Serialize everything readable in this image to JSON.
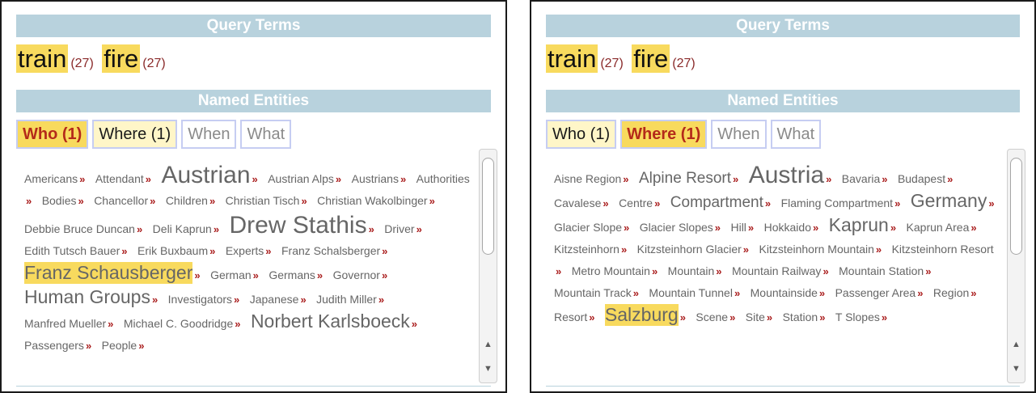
{
  "panels": [
    {
      "query_header": "Query Terms",
      "query_terms": [
        {
          "term": "train",
          "count": "(27)"
        },
        {
          "term": "fire",
          "count": "(27)"
        }
      ],
      "named_header": "Named Entities",
      "tabs": [
        "Who (1)",
        "Where (1)",
        "When",
        "What"
      ],
      "selected_tab": "Who (1)",
      "cloud": [
        {
          "text": "Americans",
          "size": 1
        },
        {
          "text": "Attendant",
          "size": 1
        },
        {
          "text": "Austrian",
          "size": 4
        },
        {
          "text": "Austrian Alps",
          "size": 1
        },
        {
          "text": "Austrians",
          "size": 1
        },
        {
          "text": "Authorities",
          "size": 1
        },
        {
          "text": "Bodies",
          "size": 1
        },
        {
          "text": "Chancellor",
          "size": 1
        },
        {
          "text": "Children",
          "size": 1
        },
        {
          "text": "Christian Tisch",
          "size": 1
        },
        {
          "text": "Christian Wakolbinger",
          "size": 1
        },
        {
          "text": "Debbie Bruce Duncan",
          "size": 1
        },
        {
          "text": "Deli Kaprun",
          "size": 1
        },
        {
          "text": "Drew Stathis",
          "size": 4
        },
        {
          "text": "Driver",
          "size": 1
        },
        {
          "text": "Edith Tutsch Bauer",
          "size": 1
        },
        {
          "text": "Erik Buxbaum",
          "size": 1
        },
        {
          "text": "Experts",
          "size": 1
        },
        {
          "text": "Franz Schalsberger",
          "size": 1
        },
        {
          "text": "Franz Schausberger",
          "size": 3,
          "highlight": true
        },
        {
          "text": "German",
          "size": 1
        },
        {
          "text": "Germans",
          "size": 1
        },
        {
          "text": "Governor",
          "size": 1
        },
        {
          "text": "Human Groups",
          "size": 3
        },
        {
          "text": "Investigators",
          "size": 1
        },
        {
          "text": "Japanese",
          "size": 1
        },
        {
          "text": "Judith Miller",
          "size": 1
        },
        {
          "text": "Manfred Mueller",
          "size": 1
        },
        {
          "text": "Michael C. Goodridge",
          "size": 1
        },
        {
          "text": "Norbert Karlsboeck",
          "size": 3
        },
        {
          "text": "Passengers",
          "size": 1
        },
        {
          "text": "People",
          "size": 1
        }
      ]
    },
    {
      "query_header": "Query Terms",
      "query_terms": [
        {
          "term": "train",
          "count": "(27)"
        },
        {
          "term": "fire",
          "count": "(27)"
        }
      ],
      "named_header": "Named Entities",
      "tabs": [
        "Who (1)",
        "Where (1)",
        "When",
        "What"
      ],
      "selected_tab": "Where (1)",
      "cloud": [
        {
          "text": "Aisne Region",
          "size": 1
        },
        {
          "text": "Alpine Resort",
          "size": 2
        },
        {
          "text": "Austria",
          "size": 4
        },
        {
          "text": "Bavaria",
          "size": 1
        },
        {
          "text": "Budapest",
          "size": 1
        },
        {
          "text": "Cavalese",
          "size": 1
        },
        {
          "text": "Centre",
          "size": 1
        },
        {
          "text": "Compartment",
          "size": 2
        },
        {
          "text": "Flaming Compartment",
          "size": 1
        },
        {
          "text": "Germany",
          "size": 3
        },
        {
          "text": "Glacier Slope",
          "size": 1
        },
        {
          "text": "Glacier Slopes",
          "size": 1
        },
        {
          "text": "Hill",
          "size": 1
        },
        {
          "text": "Hokkaido",
          "size": 1
        },
        {
          "text": "Kaprun",
          "size": 3
        },
        {
          "text": "Kaprun Area",
          "size": 1
        },
        {
          "text": "Kitzsteinhorn",
          "size": 1
        },
        {
          "text": "Kitzsteinhorn Glacier",
          "size": 1
        },
        {
          "text": "Kitzsteinhorn Mountain",
          "size": 1
        },
        {
          "text": "Kitzsteinhorn Resort",
          "size": 1
        },
        {
          "text": "Metro Mountain",
          "size": 1
        },
        {
          "text": "Mountain",
          "size": 1
        },
        {
          "text": "Mountain Railway",
          "size": 1
        },
        {
          "text": "Mountain Station",
          "size": 1
        },
        {
          "text": "Mountain Track",
          "size": 1
        },
        {
          "text": "Mountain Tunnel",
          "size": 1
        },
        {
          "text": "Mountainside",
          "size": 1
        },
        {
          "text": "Passenger Area",
          "size": 1
        },
        {
          "text": "Region",
          "size": 1
        },
        {
          "text": "Resort",
          "size": 1
        },
        {
          "text": "Salzburg",
          "size": 3,
          "highlight": true
        },
        {
          "text": "Scene",
          "size": 1
        },
        {
          "text": "Site",
          "size": 1
        },
        {
          "text": "Station",
          "size": 1
        },
        {
          "text": "T Slopes",
          "size": 1
        }
      ]
    }
  ],
  "scroll": {
    "up_arrow": "▲",
    "down_arrow": "▼"
  },
  "entity_arrow": "»",
  "colors": {
    "header_bg": "#b8d2dd",
    "highlight": "#f8da5e",
    "selected_tab_text": "#b42a1a",
    "arrow": "#aa1e1e",
    "tab_border": "#c6cdf2"
  }
}
